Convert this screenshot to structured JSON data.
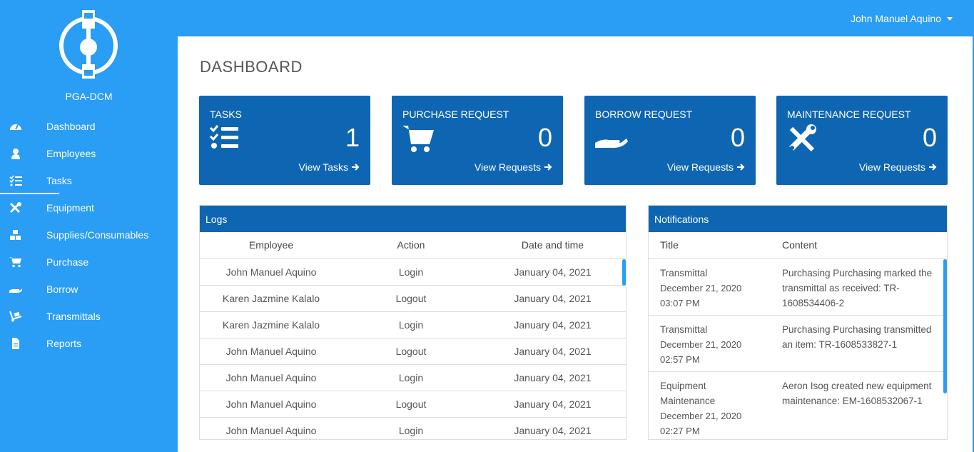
{
  "brand": "PGA-DCM",
  "sidebar": {
    "items": [
      {
        "label": "Dashboard",
        "icon": "gauge-icon"
      },
      {
        "label": "Employees",
        "icon": "user-icon"
      },
      {
        "label": "Tasks",
        "icon": "tasks-icon"
      },
      {
        "label": "Equipment",
        "icon": "tools-icon"
      },
      {
        "label": "Supplies/Consumables",
        "icon": "boxes-icon"
      },
      {
        "label": "Purchase",
        "icon": "cart-icon"
      },
      {
        "label": "Borrow",
        "icon": "hand-icon"
      },
      {
        "label": "Transmittals",
        "icon": "dolly-icon"
      },
      {
        "label": "Reports",
        "icon": "file-icon"
      }
    ],
    "active": "Tasks"
  },
  "topbar": {
    "user": "John Manuel Aquino"
  },
  "page_title": "DASHBOARD",
  "cards": [
    {
      "title": "TASKS",
      "count": "1",
      "link": "View Tasks"
    },
    {
      "title": "PURCHASE REQUEST",
      "count": "0",
      "link": "View Requests"
    },
    {
      "title": "BORROW REQUEST",
      "count": "0",
      "link": "View Requests"
    },
    {
      "title": "MAINTENANCE REQUEST",
      "count": "0",
      "link": "View Requests"
    }
  ],
  "logs": {
    "title": "Logs",
    "columns": [
      "Employee",
      "Action",
      "Date and time"
    ],
    "rows": [
      [
        "John Manuel Aquino",
        "Login",
        "January 04, 2021"
      ],
      [
        "Karen Jazmine Kalalo",
        "Logout",
        "January 04, 2021"
      ],
      [
        "Karen Jazmine Kalalo",
        "Login",
        "January 04, 2021"
      ],
      [
        "John Manuel Aquino",
        "Logout",
        "January 04, 2021"
      ],
      [
        "John Manuel Aquino",
        "Login",
        "January 04, 2021"
      ],
      [
        "John Manuel Aquino",
        "Logout",
        "January 04, 2021"
      ],
      [
        "John Manuel Aquino",
        "Login",
        "January 04, 2021"
      ]
    ]
  },
  "notifications": {
    "title": "Notifications",
    "columns": [
      "Title",
      "Content"
    ],
    "rows": [
      {
        "title": "Transmittal",
        "date": "December 21, 2020",
        "time": "03:07 PM",
        "content": "Purchasing Purchasing marked the transmittal as received: TR-1608534406-2"
      },
      {
        "title": "Transmittal",
        "date": "December 21, 2020",
        "time": "02:57 PM",
        "content": "Purchasing Purchasing transmitted an item: TR-1608533827-1"
      },
      {
        "title": "Equipment Maintenance",
        "date": "December 21, 2020",
        "time": "02:27 PM",
        "content": "Aeron Isog created new equipment maintenance: EM-1608532067-1"
      }
    ]
  },
  "colors": {
    "sidebar": "#2a9df4",
    "card": "#0e66b3",
    "accent": "#2a9df4"
  }
}
